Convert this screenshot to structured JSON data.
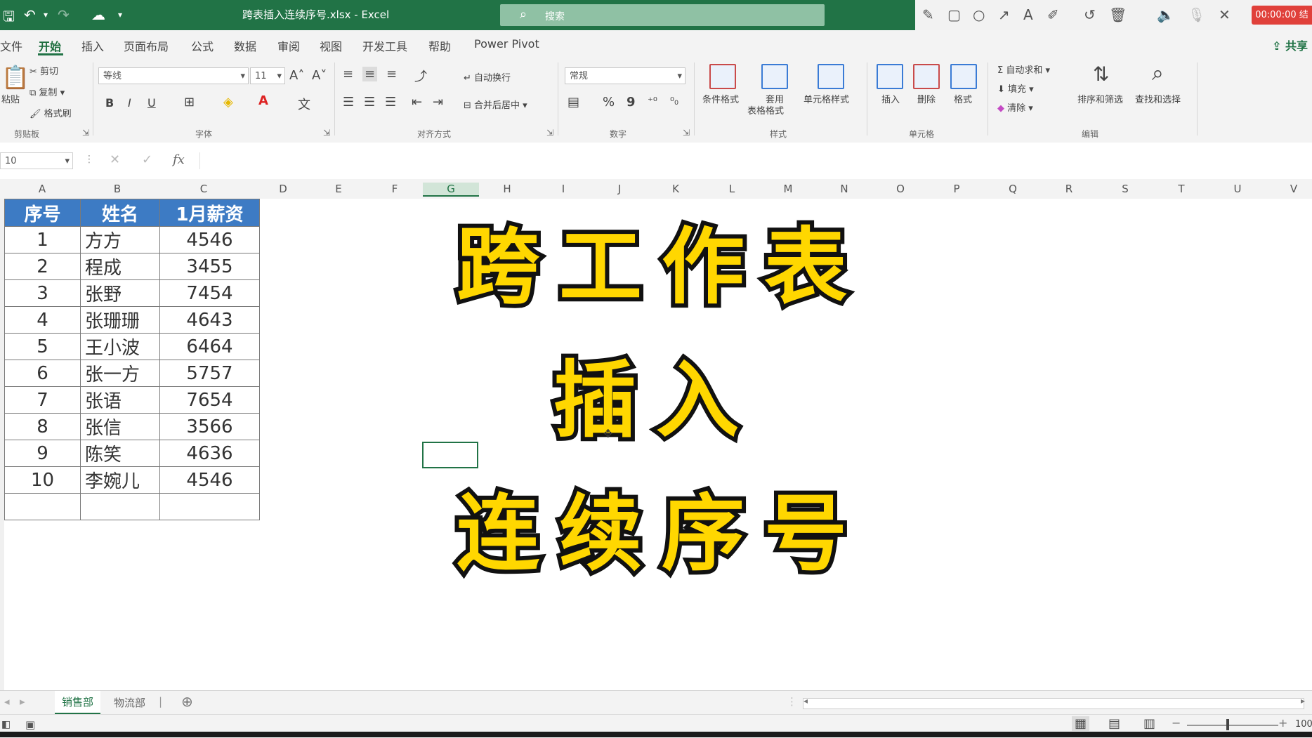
{
  "titlebar": {
    "title": "跨表插入连续序号.xlsx  -  Excel",
    "search_placeholder": "搜索",
    "timer": "00:00:00 结"
  },
  "menu": {
    "tabs": [
      "文件",
      "开始",
      "插入",
      "页面布局",
      "公式",
      "数据",
      "审阅",
      "视图",
      "开发工具",
      "帮助",
      "Power Pivot"
    ],
    "active": "开始",
    "share": "共享"
  },
  "ribbon": {
    "clipboard": {
      "cut": "剪切",
      "copy": "复制",
      "format_painter": "格式刷",
      "paste": "粘贴",
      "label": "剪贴板"
    },
    "font": {
      "name": "等线",
      "size": "11",
      "bold": "B",
      "italic": "I",
      "underline": "U",
      "label": "字体"
    },
    "alignment": {
      "wrap": "自动换行",
      "merge": "合并后居中",
      "label": "对齐方式"
    },
    "number": {
      "format": "常规",
      "percent": "%",
      "comma": "9",
      "label": "数字"
    },
    "styles": {
      "conditional": "条件格式",
      "table_line1": "套用",
      "table_line2": "表格格式",
      "cell_styles": "单元格样式",
      "label": "样式"
    },
    "cells": {
      "insert": "插入",
      "delete": "删除",
      "format": "格式",
      "label": "单元格"
    },
    "editing": {
      "autosum": "自动求和",
      "fill": "填充",
      "clear": "清除",
      "sort": "排序和筛选",
      "find": "查找和选择",
      "label": "编辑"
    }
  },
  "formulabar": {
    "namebox": "10",
    "fx": "fx"
  },
  "columns": [
    "A",
    "B",
    "C",
    "D",
    "E",
    "F",
    "G",
    "H",
    "I",
    "J",
    "K",
    "L",
    "M",
    "N",
    "O",
    "P",
    "Q",
    "R",
    "S",
    "T",
    "U",
    "V"
  ],
  "table": {
    "headers": [
      "序号",
      "姓名",
      "1月薪资"
    ],
    "rows": [
      [
        "1",
        "方方",
        "4546"
      ],
      [
        "2",
        "程成",
        "3455"
      ],
      [
        "3",
        "张野",
        "7454"
      ],
      [
        "4",
        "张珊珊",
        "4643"
      ],
      [
        "5",
        "王小波",
        "6464"
      ],
      [
        "6",
        "张一方",
        "5757"
      ],
      [
        "7",
        "张语",
        "7654"
      ],
      [
        "8",
        "张信",
        "3566"
      ],
      [
        "9",
        "陈笑",
        "4636"
      ],
      [
        "10",
        "李婉儿",
        "4546"
      ]
    ]
  },
  "overlay": {
    "line1": "跨工作表",
    "line2": "插入",
    "line3": "连续序号"
  },
  "sheets": {
    "tabs": [
      "销售部",
      "物流部"
    ],
    "active": "销售部"
  },
  "status": {
    "zoom": "100"
  }
}
